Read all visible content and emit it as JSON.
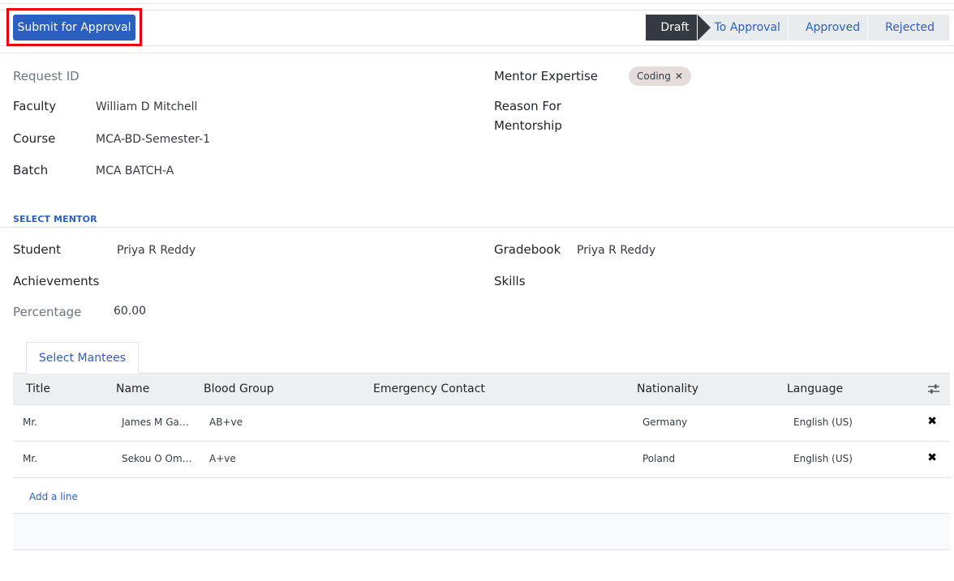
{
  "toolbar": {
    "submit_label": "Submit for Approval"
  },
  "stages": [
    "Draft",
    "To Approval",
    "Approved",
    "Rejected"
  ],
  "form": {
    "request_id_label": "Request ID",
    "faculty_label": "Faculty",
    "faculty_value": "William D Mitchell",
    "course_label": "Course",
    "course_value": "MCA-BD-Semester-1",
    "batch_label": "Batch",
    "batch_value": "MCA BATCH-A",
    "mentor_expertise_label": "Mentor Expertise",
    "mentor_expertise_tag": "Coding",
    "reason_label_line1": "Reason For",
    "reason_label_line2": "Mentorship"
  },
  "select_mentor": {
    "section_title": "SELECT MENTOR",
    "student_label": "Student",
    "student_value": "Priya R Reddy",
    "gradebook_label": "Gradebook",
    "gradebook_value": "Priya R Reddy",
    "achievements_label": "Achievements",
    "skills_label": "Skills",
    "percentage_label": "Percentage",
    "percentage_value": "60.00"
  },
  "tab": {
    "label": "Select Mantees"
  },
  "table": {
    "columns": [
      "Title",
      "Name",
      "Blood Group",
      "Emergency Contact",
      "Nationality",
      "Language"
    ],
    "rows": [
      {
        "title": "Mr.",
        "name": "James M Ga…",
        "blood_group": "AB+ve",
        "emergency_contact": "",
        "nationality": "Germany",
        "language": "English (US)"
      },
      {
        "title": "Mr.",
        "name": "Sekou O Om…",
        "blood_group": "A+ve",
        "emergency_contact": "",
        "nationality": "Poland",
        "language": "English (US)"
      }
    ],
    "add_line_label": "Add a line"
  },
  "icons": {
    "remove_tag": "close-icon",
    "delete_row": "delete-x-icon",
    "column_settings": "sliders-icon"
  },
  "colors": {
    "primary": "#2b60c1",
    "active_stage": "#343a40",
    "highlight": "#e8000b",
    "tag_bg": "#e5dcdc"
  }
}
